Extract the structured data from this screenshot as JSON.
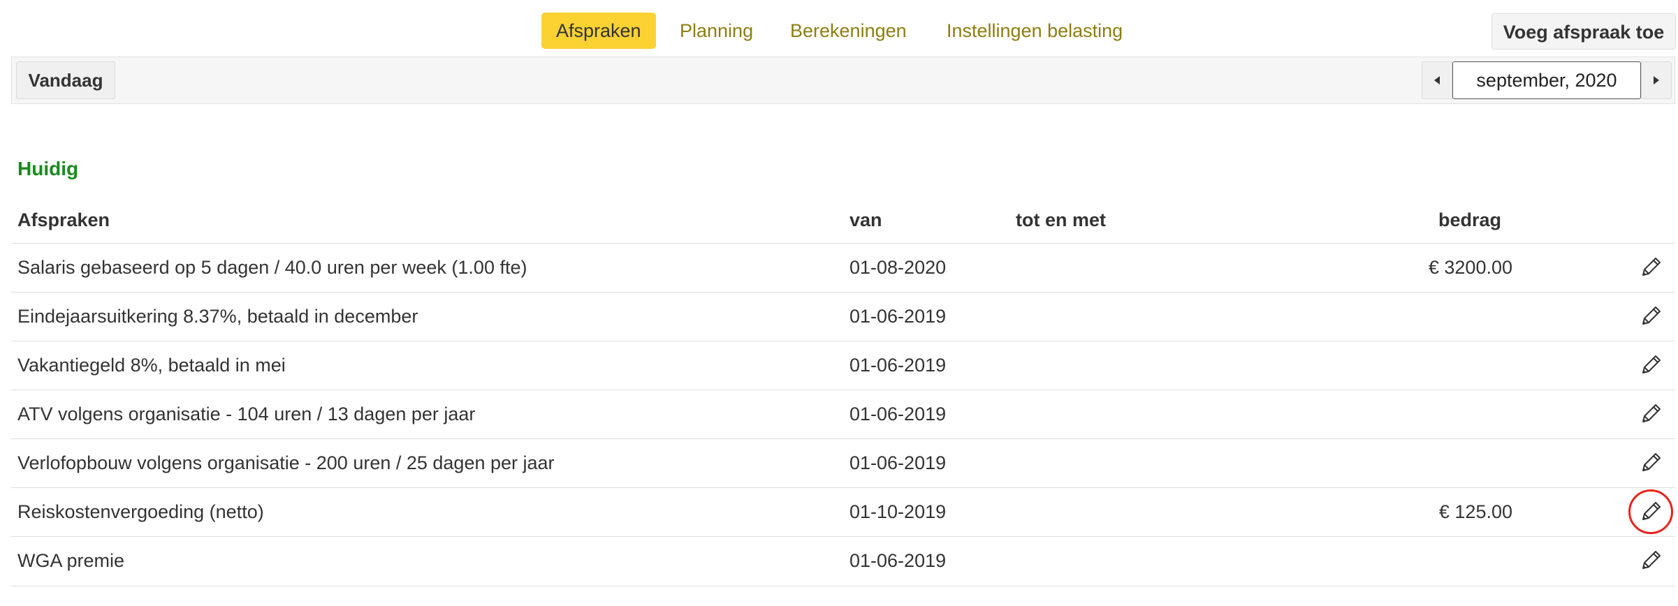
{
  "nav": {
    "tabs": [
      {
        "label": "Afspraken",
        "active": true
      },
      {
        "label": "Planning",
        "active": false
      },
      {
        "label": "Berekeningen",
        "active": false
      },
      {
        "label": "Instellingen belasting",
        "active": false
      }
    ],
    "add_button": "Voeg afspraak toe"
  },
  "toolbar": {
    "today_button": "Vandaag",
    "prev_icon": "caret-left-icon",
    "next_icon": "caret-right-icon",
    "date": "september, 2020"
  },
  "section": {
    "title": "Huidig"
  },
  "table": {
    "headers": {
      "description": "Afspraken",
      "from": "van",
      "to": "tot en met",
      "amount": "bedrag"
    },
    "edit_icon": "pencil-icon",
    "rows": [
      {
        "description": "Salaris gebaseerd op 5 dagen / 40.0 uren per week (1.00 fte)",
        "from": "01-08-2020",
        "to": "",
        "amount": "€ 3200.00"
      },
      {
        "description": "Eindejaarsuitkering 8.37%, betaald in december",
        "from": "01-06-2019",
        "to": "",
        "amount": ""
      },
      {
        "description": "Vakantiegeld 8%, betaald in mei",
        "from": "01-06-2019",
        "to": "",
        "amount": ""
      },
      {
        "description": "ATV volgens organisatie - 104 uren / 13 dagen per jaar",
        "from": "01-06-2019",
        "to": "",
        "amount": ""
      },
      {
        "description": "Verlofopbouw volgens organisatie - 200 uren / 25 dagen per jaar",
        "from": "01-06-2019",
        "to": "",
        "amount": ""
      },
      {
        "description": "Reiskostenvergoeding (netto)",
        "from": "01-10-2019",
        "to": "",
        "amount": "€ 125.00"
      },
      {
        "description": "WGA premie",
        "from": "01-06-2019",
        "to": "",
        "amount": ""
      }
    ]
  },
  "colors": {
    "accent": "#fbd232",
    "tab_text": "#8e7d10",
    "section_title": "#198a1f",
    "highlight_circle": "#e8231b"
  }
}
